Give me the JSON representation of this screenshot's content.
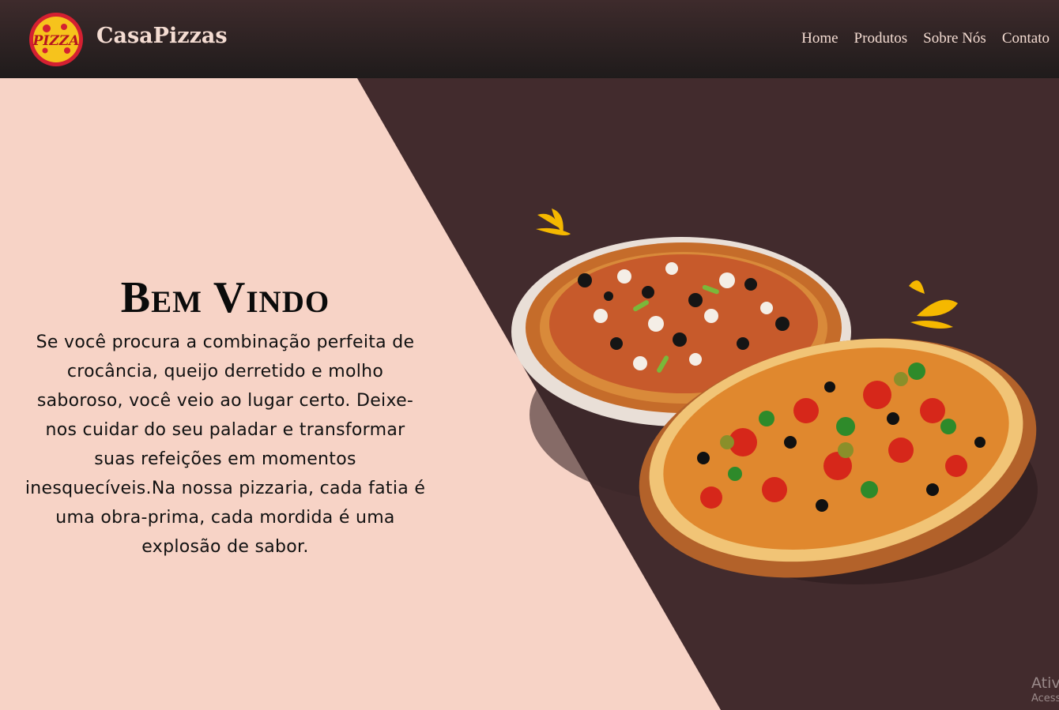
{
  "header": {
    "logo_text": "PIZZA",
    "brand": "CasaPizzas",
    "nav": [
      "Home",
      "Produtos",
      "Sobre Nós",
      "Contato"
    ]
  },
  "hero": {
    "title": "Bem Vindo",
    "body": "Se você procura a combinação perfeita de crocância, queijo derretido e molho saboroso, você veio ao lugar certo. Deixe-nos cuidar do seu paladar e transformar suas refeições em momentos inesquecíveis.Na nossa pizzaria, cada fatia é uma obra-prima, cada mordida é uma explosão de sabor."
  },
  "watermark": {
    "line1": "Ativ",
    "line2": "Acess"
  },
  "colors": {
    "light_panel": "#f7d3c6",
    "dark_panel": "#422b2d",
    "header": "#2a1f20",
    "accent_yellow": "#f5b800"
  }
}
